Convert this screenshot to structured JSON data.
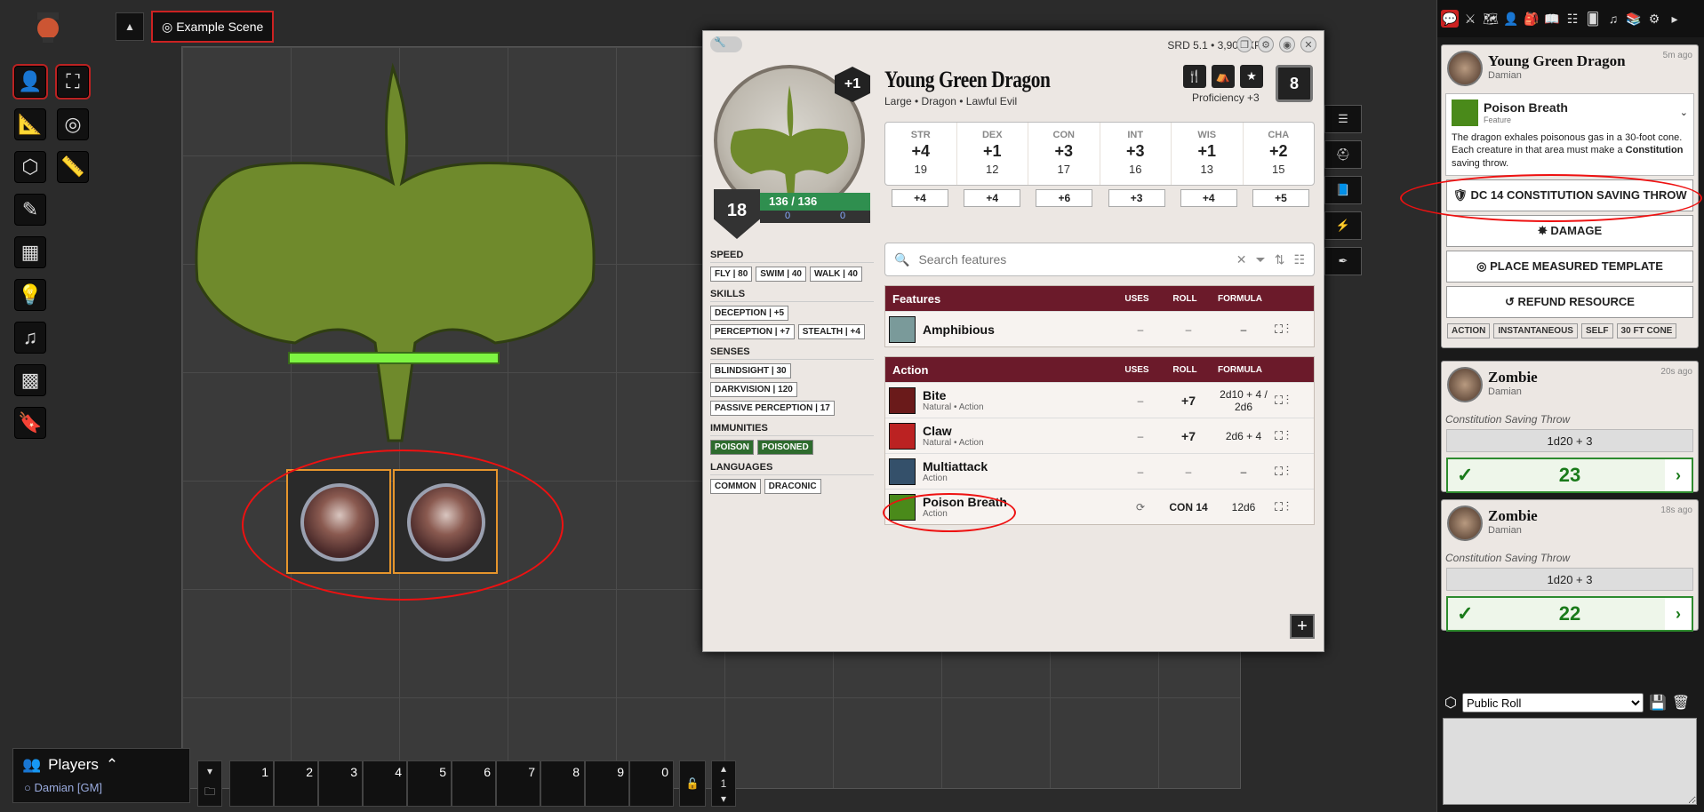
{
  "scene": {
    "title": "Example Scene",
    "toggle": "▲"
  },
  "players": {
    "header": "Players",
    "user": "Damian [GM]"
  },
  "hotbar": {
    "slots": [
      "1",
      "2",
      "3",
      "4",
      "5",
      "6",
      "7",
      "8",
      "9",
      "0"
    ],
    "page": "1"
  },
  "sheet": {
    "meta": "SRD 5.1 • 3,900 XP",
    "name": "Young Green Dragon",
    "subtitle": "Large • Dragon • Lawful Evil",
    "level_badge": "+1",
    "ac": "18",
    "hp": "136 / 136",
    "hp_temp": "0",
    "hp_tempmax": "0",
    "proficiency": "Proficiency +3",
    "pb": "8",
    "abilities": [
      {
        "label": "STR",
        "mod": "+4",
        "score": "19",
        "save": "+4"
      },
      {
        "label": "DEX",
        "mod": "+1",
        "score": "12",
        "save": "+4"
      },
      {
        "label": "CON",
        "mod": "+3",
        "score": "17",
        "save": "+6"
      },
      {
        "label": "INT",
        "mod": "+3",
        "score": "16",
        "save": "+3"
      },
      {
        "label": "WIS",
        "mod": "+1",
        "score": "13",
        "save": "+4"
      },
      {
        "label": "CHA",
        "mod": "+2",
        "score": "15",
        "save": "+5"
      }
    ],
    "speed_h": "SPEED",
    "speeds": [
      "FLY | 80",
      "SWIM | 40",
      "WALK | 40"
    ],
    "skills_h": "SKILLS",
    "skills": [
      "DECEPTION | +5",
      "PERCEPTION | +7",
      "STEALTH | +4"
    ],
    "senses_h": "SENSES",
    "senses": [
      "BLINDSIGHT | 30",
      "DARKVISION | 120",
      "PASSIVE PERCEPTION | 17"
    ],
    "immun_h": "IMMUNITIES",
    "immunities": [
      "POISON",
      "POISONED"
    ],
    "lang_h": "LANGUAGES",
    "languages": [
      "COMMON",
      "DRACONIC"
    ],
    "search_placeholder": "Search features",
    "features": {
      "title": "Features",
      "cols": [
        "USES",
        "ROLL",
        "FORMULA"
      ],
      "rows": [
        {
          "name": "Amphibious",
          "sub": "",
          "uses": "–",
          "roll": "–",
          "formula": "–"
        }
      ]
    },
    "actions": {
      "title": "Action",
      "cols": [
        "USES",
        "ROLL",
        "FORMULA"
      ],
      "rows": [
        {
          "name": "Bite",
          "sub": "Natural • Action",
          "uses": "–",
          "roll": "+7",
          "formula": "2d10 + 4 / 2d6"
        },
        {
          "name": "Claw",
          "sub": "Natural • Action",
          "uses": "–",
          "roll": "+7",
          "formula": "2d6 + 4"
        },
        {
          "name": "Multiattack",
          "sub": "Action",
          "uses": "–",
          "roll": "–",
          "formula": "–"
        },
        {
          "name": "Poison Breath",
          "sub": "Action",
          "uses": "⟳",
          "roll": "CON 14",
          "formula": "12d6"
        }
      ]
    }
  },
  "chat": {
    "card": {
      "who": "Young Green Dragon",
      "speaker": "Damian",
      "ago": "5m ago",
      "item": "Poison Breath",
      "item_type": "Feature",
      "desc_pre": "The dragon exhales poisonous gas in a 30-foot cone. Each creature in that area must make a ",
      "desc_bold": "Constitution",
      "desc_post": " saving throw.",
      "buttons": [
        "DC 14 CONSTITUTION SAVING THROW",
        "DAMAGE",
        "PLACE MEASURED TEMPLATE",
        "REFUND RESOURCE"
      ],
      "tags": [
        "ACTION",
        "INSTANTANEOUS",
        "SELF",
        "30 FT CONE"
      ]
    },
    "rolls": [
      {
        "who": "Zombie",
        "speaker": "Damian",
        "ago": "20s ago",
        "flavor": "Constitution Saving Throw",
        "formula": "1d20 + 3",
        "total": "23"
      },
      {
        "who": "Zombie",
        "speaker": "Damian",
        "ago": "18s ago",
        "flavor": "Constitution Saving Throw",
        "formula": "1d20 + 3",
        "total": "22"
      }
    ],
    "roll_mode": "Public Roll"
  }
}
